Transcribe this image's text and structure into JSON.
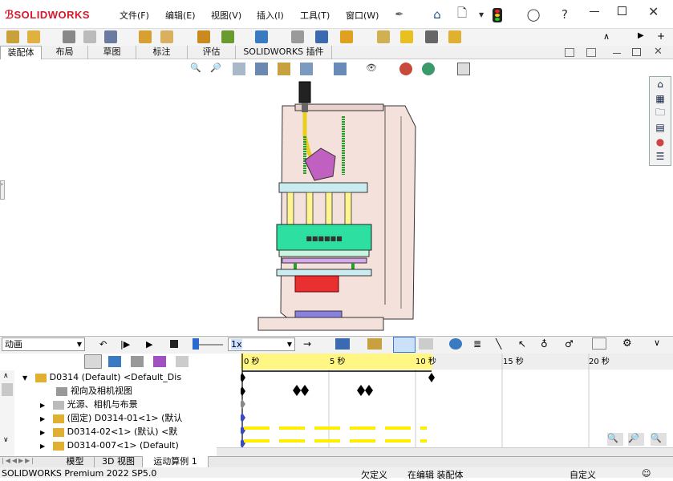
{
  "app": {
    "logo": "SOLIDWORKS"
  },
  "menu": {
    "items": [
      "文件(F)",
      "编辑(E)",
      "视图(V)",
      "插入(I)",
      "工具(T)",
      "窗口(W)"
    ]
  },
  "command_tabs": [
    "装配体",
    "布局",
    "草图",
    "标注",
    "评估",
    "SOLIDWORKS 插件"
  ],
  "motion": {
    "study_type": "动画",
    "speed": "1x"
  },
  "timeline": {
    "ticks": [
      "0 秒",
      "5 秒",
      "10 秒",
      "15 秒",
      "20 秒"
    ]
  },
  "tree": {
    "rows": [
      {
        "label": "D0314 (Default) <Default_Dis"
      },
      {
        "label": "视向及相机视图"
      },
      {
        "label": "光源、相机与布景"
      },
      {
        "label": "(固定) D0314-01<1> (默认"
      },
      {
        "label": "D0314-02<1> (默认) <默"
      },
      {
        "label": "D0314-007<1> (Default)"
      }
    ]
  },
  "model_label": "■■■■■■",
  "bottom_tabs": [
    "模型",
    "3D 视图",
    "运动算例 1"
  ],
  "status": {
    "product": "SOLIDWORKS Premium 2022 SP5.0",
    "definition": "欠定义",
    "mode": "在编辑 装配体",
    "custom": "自定义"
  },
  "colors": {
    "accent": "#d7182a",
    "timeline_header": "#fff684",
    "track": "#ffee00"
  }
}
